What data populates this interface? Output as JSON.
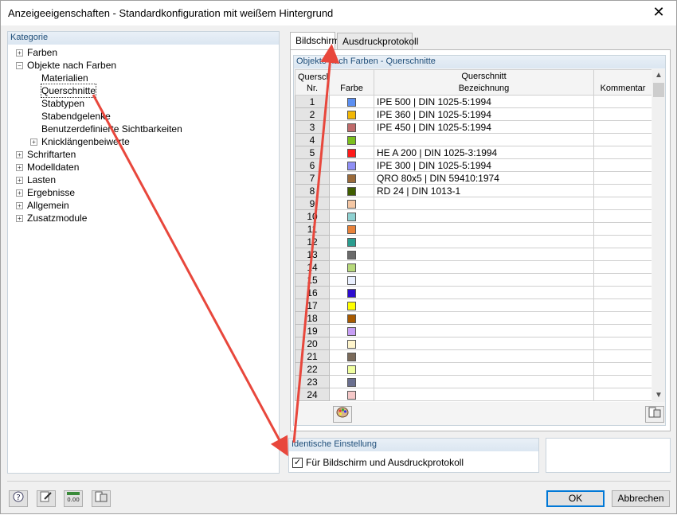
{
  "window": {
    "title": "Anzeigeeigenschaften - Standardkonfiguration mit weißem Hintergrund",
    "close_glyph": "✕"
  },
  "kategorie": {
    "header": "Kategorie",
    "tree": [
      {
        "label": "Farben",
        "expander": "+",
        "level": 0
      },
      {
        "label": "Objekte nach Farben",
        "expander": "−",
        "level": 0
      },
      {
        "label": "Materialien",
        "expander": "",
        "level": 1
      },
      {
        "label": "Querschnitte",
        "expander": "",
        "level": 1,
        "selected": true
      },
      {
        "label": "Stabtypen",
        "expander": "",
        "level": 1
      },
      {
        "label": "Stabendgelenke",
        "expander": "",
        "level": 1
      },
      {
        "label": "Benutzerdefinierte Sichtbarkeiten",
        "expander": "",
        "level": 1
      },
      {
        "label": "Knicklängenbeiwerte",
        "expander": "+",
        "level": 1
      },
      {
        "label": "Schriftarten",
        "expander": "+",
        "level": 0
      },
      {
        "label": "Modelldaten",
        "expander": "+",
        "level": 0
      },
      {
        "label": "Lasten",
        "expander": "+",
        "level": 0
      },
      {
        "label": "Ergebnisse",
        "expander": "+",
        "level": 0
      },
      {
        "label": "Allgemein",
        "expander": "+",
        "level": 0
      },
      {
        "label": "Zusatzmodule",
        "expander": "+",
        "level": 0
      }
    ]
  },
  "tabs": {
    "bildschirm": "Bildschirm",
    "ausdruckprotokoll": "Ausdruckprotokoll"
  },
  "grid": {
    "group_title": "Objekte nach Farben - Querschnitte",
    "col_nr_line1": "Quersch.",
    "col_nr_line2": "Nr.",
    "col_farbe": "Farbe",
    "col_qs_line1": "Querschnitt",
    "col_qs_line2": "Bezeichnung",
    "col_kommentar": "Kommentar",
    "rows": [
      {
        "nr": "1",
        "color": "#5b8ff2",
        "name": "IPE 500 | DIN 1025-5:1994",
        "kommentar": ""
      },
      {
        "nr": "2",
        "color": "#f2b705",
        "name": "IPE 360 | DIN 1025-5:1994",
        "kommentar": ""
      },
      {
        "nr": "3",
        "color": "#c06b6b",
        "name": "IPE 450 | DIN 1025-5:1994",
        "kommentar": ""
      },
      {
        "nr": "4",
        "color": "#7cbf1d",
        "name": "",
        "kommentar": ""
      },
      {
        "nr": "5",
        "color": "#ff1a1a",
        "name": "HE A 200 | DIN 1025-3:1994",
        "kommentar": ""
      },
      {
        "nr": "6",
        "color": "#8f8ff5",
        "name": "IPE 300 | DIN 1025-5:1994",
        "kommentar": ""
      },
      {
        "nr": "7",
        "color": "#9a6a3a",
        "name": "QRO 80x5 | DIN 59410:1974",
        "kommentar": ""
      },
      {
        "nr": "8",
        "color": "#3f5d00",
        "name": "RD 24 | DIN 1013-1",
        "kommentar": ""
      },
      {
        "nr": "9",
        "color": "#f5c7a4",
        "name": "",
        "kommentar": ""
      },
      {
        "nr": "10",
        "color": "#8fd1d1",
        "name": "",
        "kommentar": ""
      },
      {
        "nr": "11",
        "color": "#e8823a",
        "name": "",
        "kommentar": ""
      },
      {
        "nr": "12",
        "color": "#2a9d8f",
        "name": "",
        "kommentar": ""
      },
      {
        "nr": "13",
        "color": "#6a6a6a",
        "name": "",
        "kommentar": ""
      },
      {
        "nr": "14",
        "color": "#b7d97a",
        "name": "",
        "kommentar": ""
      },
      {
        "nr": "15",
        "color": "#eaf0ff",
        "name": "",
        "kommentar": ""
      },
      {
        "nr": "16",
        "color": "#2d0ccf",
        "name": "",
        "kommentar": ""
      },
      {
        "nr": "17",
        "color": "#ffff00",
        "name": "",
        "kommentar": ""
      },
      {
        "nr": "18",
        "color": "#a85a00",
        "name": "",
        "kommentar": ""
      },
      {
        "nr": "19",
        "color": "#c79ef5",
        "name": "",
        "kommentar": ""
      },
      {
        "nr": "20",
        "color": "#fff5cc",
        "name": "",
        "kommentar": ""
      },
      {
        "nr": "21",
        "color": "#7a6a5a",
        "name": "",
        "kommentar": ""
      },
      {
        "nr": "22",
        "color": "#f0ffa0",
        "name": "",
        "kommentar": ""
      },
      {
        "nr": "23",
        "color": "#6a6f8f",
        "name": "",
        "kommentar": ""
      },
      {
        "nr": "24",
        "color": "#f5c8c8",
        "name": "",
        "kommentar": ""
      }
    ]
  },
  "identisch": {
    "header": "Identische Einstellung",
    "checkbox_label": "Für Bildschirm und Ausdruckprotokoll",
    "checked": true
  },
  "buttons": {
    "ok": "OK",
    "abbrechen": "Abbrechen"
  },
  "annotation": {
    "arrow_color": "#e8473c"
  }
}
